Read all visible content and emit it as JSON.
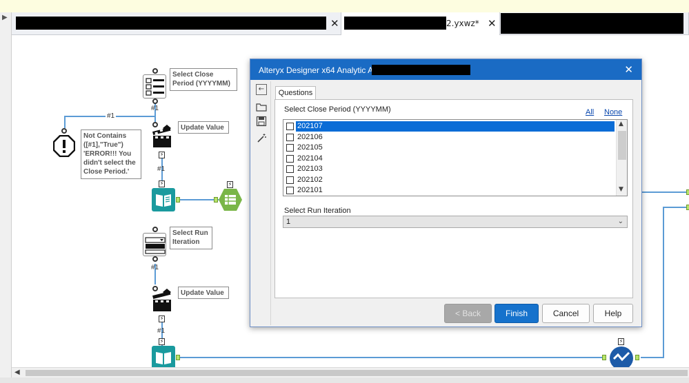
{
  "tabs": [
    {
      "label": "",
      "active": false
    },
    {
      "label": "2.yxwz*",
      "active": true
    },
    {
      "label": "",
      "active": false
    }
  ],
  "workflow": {
    "wire_label": "#1",
    "anchor_label": "#1",
    "notes": {
      "select_close": "Select Close Period (YYYYMM)",
      "not_contains": "Not Contains ([#1],\"True\") 'ERROR!!! You didn't select the Close Period.'",
      "update_value_1": "Update Value",
      "select_run": "Select Run Iteration",
      "update_value_2": "Update Value"
    }
  },
  "dialog": {
    "title": "Alteryx Designer x64 Analytic App - ",
    "close_glyph": "✕",
    "tab_label": "Questions",
    "question1": {
      "label": "Select Close Period (YYYYMM)",
      "all_link": "All",
      "none_link": "None",
      "items": [
        {
          "label": "202107",
          "checked": false,
          "selected": true
        },
        {
          "label": "202106",
          "checked": false,
          "selected": false
        },
        {
          "label": "202105",
          "checked": false,
          "selected": false
        },
        {
          "label": "202104",
          "checked": false,
          "selected": false
        },
        {
          "label": "202103",
          "checked": false,
          "selected": false
        },
        {
          "label": "202102",
          "checked": false,
          "selected": false
        },
        {
          "label": "202101",
          "checked": false,
          "selected": false
        }
      ]
    },
    "question2": {
      "label": "Select Run Iteration",
      "value": "1"
    },
    "buttons": {
      "back": "< Back",
      "finish": "Finish",
      "cancel": "Cancel",
      "help": "Help"
    }
  },
  "colors": {
    "title_bar": "#1a6bc4",
    "primary_button": "#1672cc",
    "selection": "#0a6cd6",
    "wire": "#5b9bd5",
    "tool_teal": "#1a9a9e",
    "tool_green": "#7ab648"
  }
}
